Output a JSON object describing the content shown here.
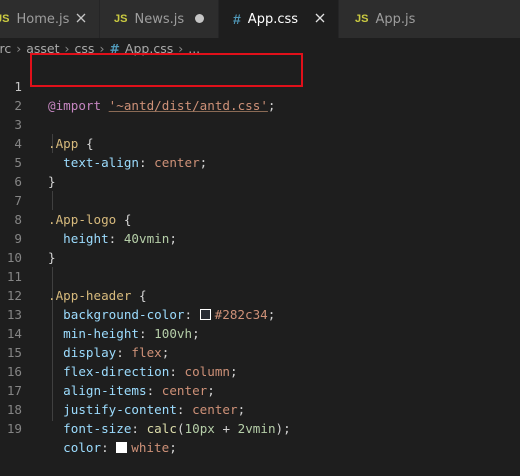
{
  "tabs": [
    {
      "icon": "JS",
      "label": "Home.js",
      "state": "close"
    },
    {
      "icon": "JS",
      "label": "News.js",
      "state": "dot"
    },
    {
      "icon": "#",
      "label": "App.css",
      "state": "close"
    },
    {
      "icon": "JS",
      "label": "App.js",
      "state": "none"
    }
  ],
  "breadcrumb": {
    "items": [
      "src",
      "asset",
      "css"
    ],
    "file_icon": "#",
    "file": "App.css",
    "ellipsis": "..."
  },
  "editor": {
    "line_numbers": [
      "1",
      "2",
      "3",
      "4",
      "5",
      "6",
      "7",
      "8",
      "9",
      "10",
      "11",
      "12",
      "13",
      "14",
      "15",
      "16",
      "17",
      "18",
      "19"
    ],
    "l1": {
      "at": "@import",
      "str": "'~antd/dist/antd.css'",
      "end": ";"
    },
    "l3": {
      "sel": ".App",
      "brace": "{"
    },
    "l4": {
      "prop": "text-align",
      "val": "center"
    },
    "l5": {
      "brace": "}"
    },
    "l7": {
      "sel": ".App-logo",
      "brace": "{"
    },
    "l8": {
      "prop": "height",
      "num": "40vmin"
    },
    "l9": {
      "brace": "}"
    },
    "l11": {
      "sel": ".App-header",
      "brace": "{"
    },
    "l12": {
      "prop": "background-color",
      "val": "#282c34",
      "swatch": "#282c34"
    },
    "l13": {
      "prop": "min-height",
      "num": "100vh"
    },
    "l14": {
      "prop": "display",
      "val": "flex"
    },
    "l15": {
      "prop": "flex-direction",
      "val": "column"
    },
    "l16": {
      "prop": "align-items",
      "val": "center"
    },
    "l17": {
      "prop": "justify-content",
      "val": "center"
    },
    "l18": {
      "prop": "font-size",
      "fn": "calc",
      "open": "(",
      "num1": "10px",
      "op": " + ",
      "num2": "2vmin",
      "close": ")"
    },
    "l19": {
      "prop": "color",
      "val": "white",
      "swatch": "#ffffff"
    }
  },
  "colors": {
    "highlight_box": "#e0101a",
    "editor_bg": "#1e1e1e"
  }
}
